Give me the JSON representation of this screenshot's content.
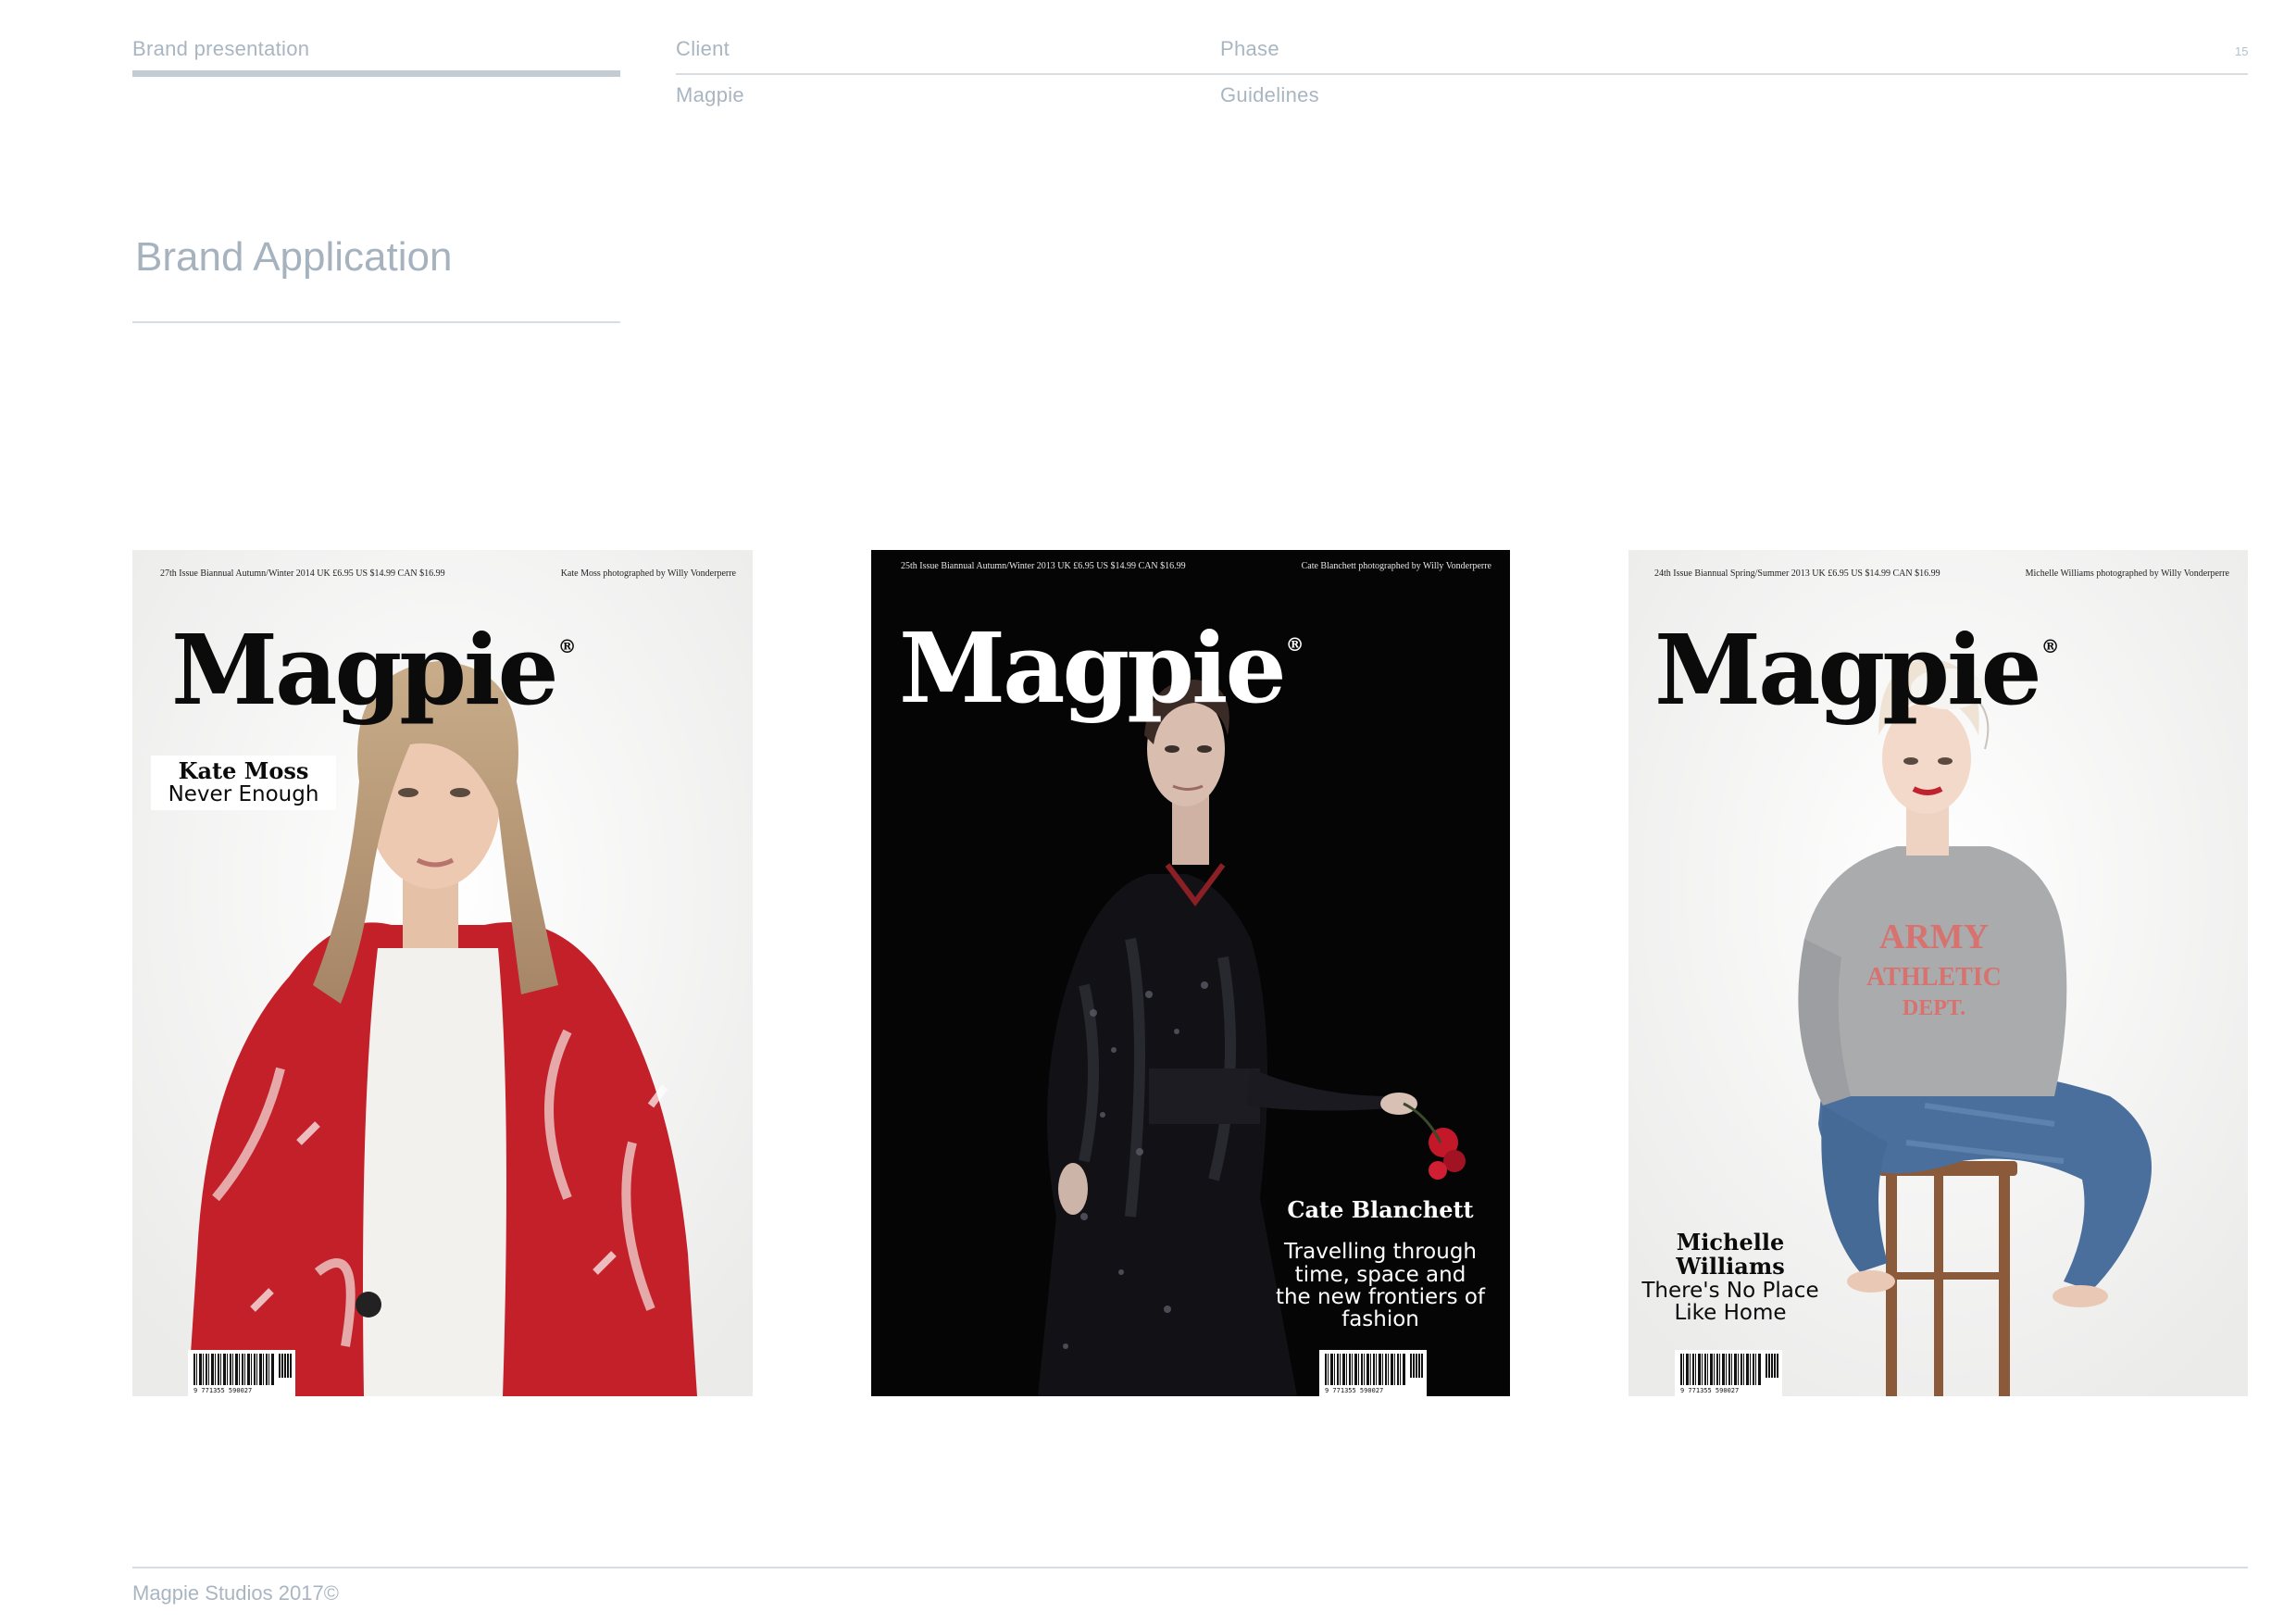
{
  "header": {
    "doc_type": "Brand presentation",
    "client_label": "Client",
    "client_value": "Magpie",
    "phase_label": "Phase",
    "phase_value": "Guidelines",
    "page_number": "15"
  },
  "section": {
    "title": "Brand Application"
  },
  "covers": [
    {
      "issue_info": "27th Issue Biannual Autumn/Winter 2014  UK £6.95  US $14.99  CAN $16.99",
      "credit": "Kate Moss photographed by Willy Vonderperre",
      "masthead": "Magpie",
      "reg_mark": "®",
      "name": "Kate Moss",
      "tagline": [
        "Never Enough"
      ],
      "barcode_number": "9 771355 590027",
      "theme": "light"
    },
    {
      "issue_info": "25th Issue Biannual Autumn/Winter 2013  UK £6.95  US $14.99  CAN $16.99",
      "credit": "Cate Blanchett photographed by Willy Vonderperre",
      "masthead": "Magpie",
      "reg_mark": "®",
      "name": "Cate Blanchett",
      "tagline": [
        "Travelling through",
        "time, space and",
        "the new frontiers of",
        "fashion"
      ],
      "barcode_number": "9 771355 590027",
      "theme": "dark"
    },
    {
      "issue_info": "24th Issue Biannual Spring/Summer 2013  UK £6.95  US $14.99  CAN $16.99",
      "credit": "Michelle Williams photographed by Willy Vonderperre",
      "masthead": "Magpie",
      "reg_mark": "®",
      "name_lines": [
        "Michelle",
        "Williams"
      ],
      "tagline": [
        "There's No Place",
        "Like Home"
      ],
      "sweatshirt_text": [
        "ARMY",
        "ATHLETIC",
        "DEPT."
      ],
      "barcode_number": "9 771355 590027",
      "theme": "light"
    }
  ],
  "footer": {
    "text": "Magpie Studios 2017©"
  },
  "colors": {
    "meta_text": "#a9b6c1",
    "rule": "#d6dde3",
    "accent_bar": "#c3ccd3",
    "dark_cover": "#050505",
    "coat_red": "#c3202a"
  }
}
